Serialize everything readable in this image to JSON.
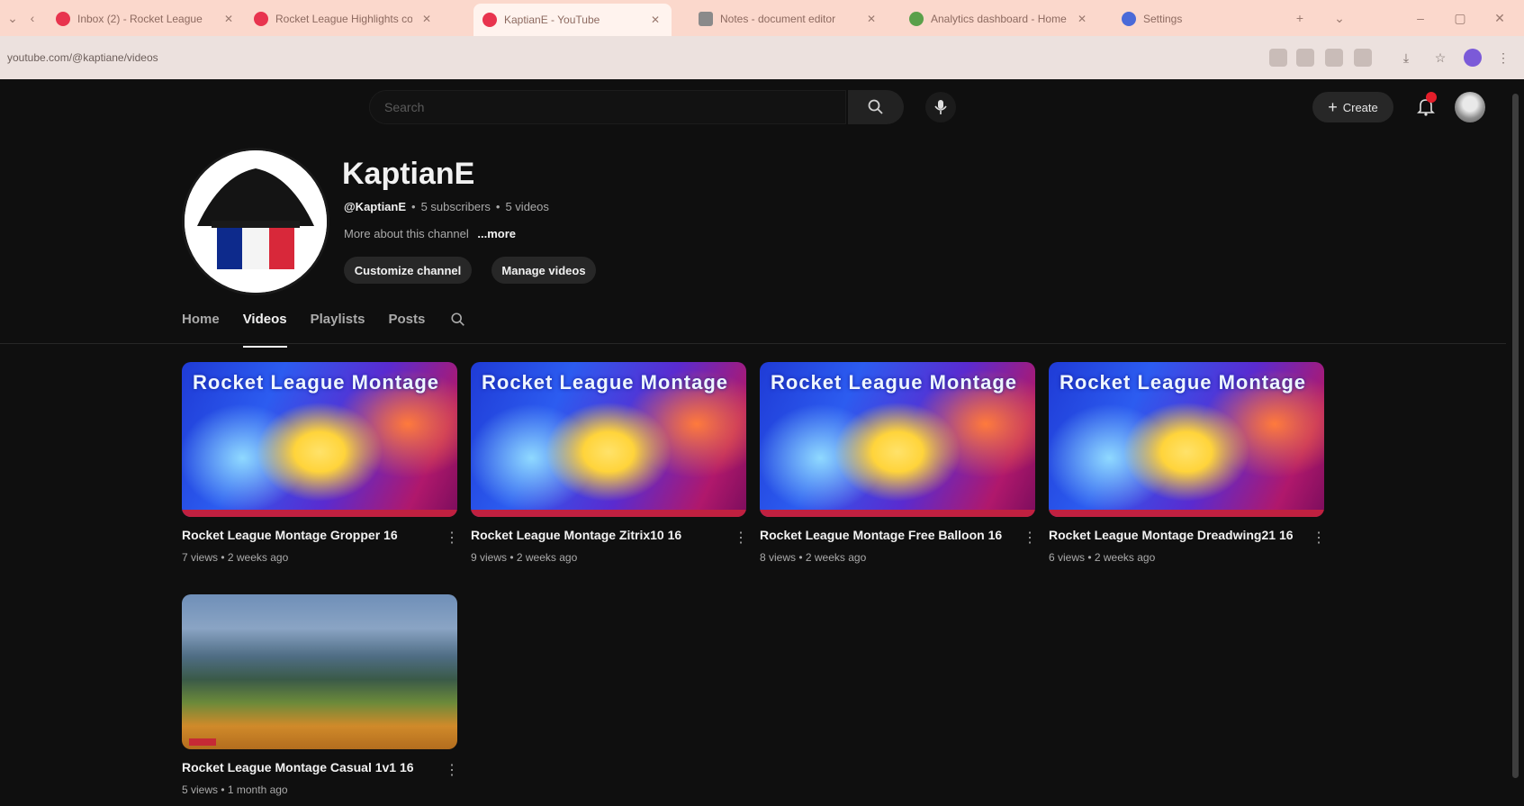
{
  "browser": {
    "tabs": [
      {
        "title": "Inbox (2) - Rocket League",
        "favicon_color": "#e8344e"
      },
      {
        "title": "Rocket League Highlights compilation",
        "favicon_color": "#e8344e"
      },
      {
        "title": "KaptianE - YouTube",
        "favicon_color": "#e8344e",
        "active": true
      },
      {
        "title": "Notes - document editor",
        "favicon_color": "#8a8a8a"
      },
      {
        "title": "Analytics dashboard - Home",
        "favicon_color": "#5aa04a"
      },
      {
        "title": "Settings",
        "favicon_color": "#4a6ad8"
      }
    ],
    "url": "youtube.com/@kaptiane/videos"
  },
  "header": {
    "search_placeholder": "Search",
    "create_label": "Create"
  },
  "channel": {
    "name": "KaptianE",
    "handle": "@KaptianE",
    "subscribers": "5 subscribers",
    "videos_count": "5 videos",
    "description": "More about this channel",
    "more_label": "...more",
    "customize_label": "Customize channel",
    "manage_label": "Manage videos"
  },
  "tabs": [
    {
      "label": "Home"
    },
    {
      "label": "Videos",
      "selected": true
    },
    {
      "label": "Playlists"
    },
    {
      "label": "Posts"
    }
  ],
  "videos": [
    {
      "title": "Rocket League Montage Gropper 16",
      "meta": "7 views • 2 weeks ago",
      "thumb_text": "Rocket League Montage"
    },
    {
      "title": "Rocket League Montage Zitrix10 16",
      "meta": "9 views • 2 weeks ago",
      "thumb_text": "Rocket League Montage"
    },
    {
      "title": "Rocket League Montage Free Balloon 16",
      "meta": "8 views • 2 weeks ago",
      "thumb_text": "Rocket League Montage"
    },
    {
      "title": "Rocket League Montage Dreadwing21 16",
      "meta": "6 views • 2 weeks ago",
      "thumb_text": "Rocket League Montage"
    },
    {
      "title": "Rocket League Montage Casual 1v1 16",
      "meta": "5 views • 1 month ago",
      "thumb_text": ""
    }
  ]
}
